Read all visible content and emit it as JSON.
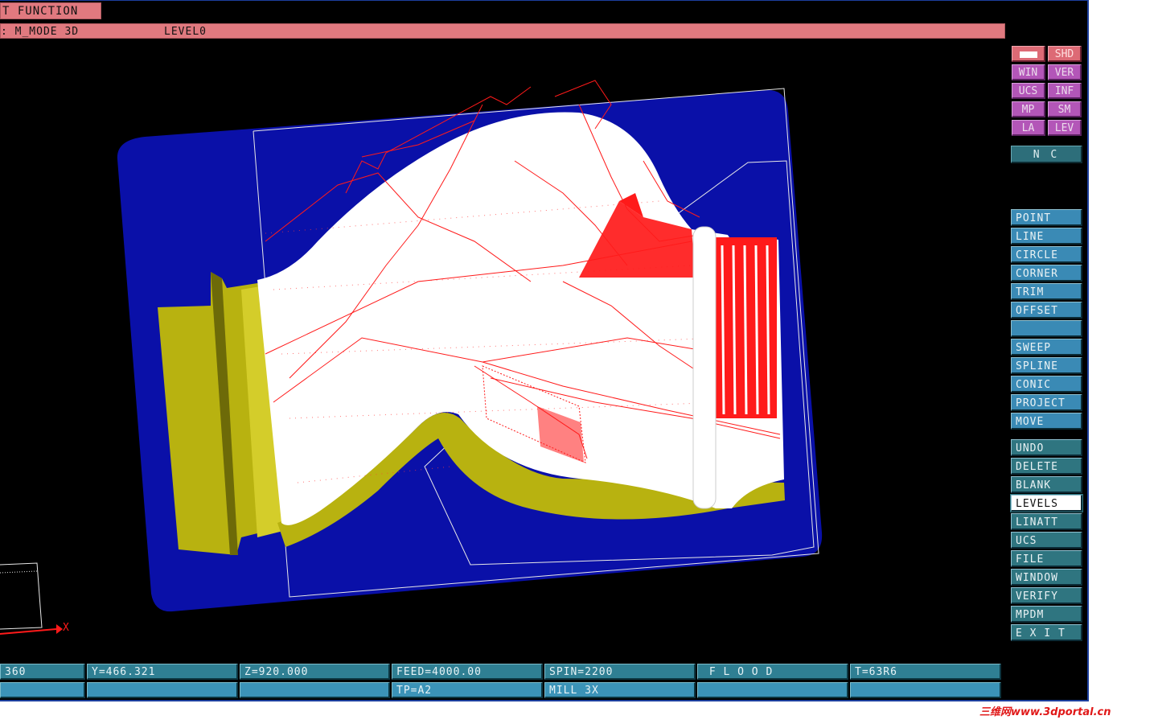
{
  "window": {
    "title": "T FUNCTION",
    "mode_line": ": M_MODE 3D            LEVEL0"
  },
  "view_buttons": [
    {
      "label": "",
      "icon": "white-swatch-icon",
      "style": "pink"
    },
    {
      "label": "SHD",
      "style": "pink"
    },
    {
      "label": "WIN",
      "style": "purple"
    },
    {
      "label": "VER",
      "style": "purple"
    },
    {
      "label": "UCS",
      "style": "purple"
    },
    {
      "label": "INF",
      "style": "purple"
    },
    {
      "label": "MP",
      "style": "purple"
    },
    {
      "label": "SM",
      "style": "purple"
    },
    {
      "label": "LA",
      "style": "purple"
    },
    {
      "label": "LEV",
      "style": "purple"
    }
  ],
  "nc_label": "N C",
  "menu": {
    "create_items": [
      "POINT",
      "LINE",
      "CIRCLE",
      "CORNER",
      "TRIM",
      "OFFSET",
      "",
      "SWEEP",
      "SPLINE",
      "CONIC",
      "PROJECT",
      "MOVE"
    ],
    "tool_items": [
      "UNDO",
      "DELETE",
      "BLANK",
      "LEVELS",
      "LINATT",
      "UCS",
      "FILE",
      "WINDOW",
      "VERIFY",
      "MPDM",
      "E X I T"
    ],
    "active_item": "LEVELS"
  },
  "status": {
    "row1": [
      "360",
      "Y=466.321",
      "Z=920.000",
      "FEED=4000.00",
      "SPIN=2200",
      " F L O O D",
      "T=63R6"
    ],
    "row2": [
      "",
      "",
      "",
      "TP=A2",
      "MILL 3X",
      "",
      ""
    ]
  },
  "axis": {
    "x_label": "X"
  },
  "watermark": "三维网www.3dportal.cn",
  "colors": {
    "title_bar": "#e0797f",
    "model_background": "#0a10a8",
    "part_body": "#ffffff",
    "part_flange": "#b8b210",
    "toolpath": "#ff1a1a",
    "menu_blue": "#3a8ab5",
    "menu_teal": "#2f7580"
  }
}
